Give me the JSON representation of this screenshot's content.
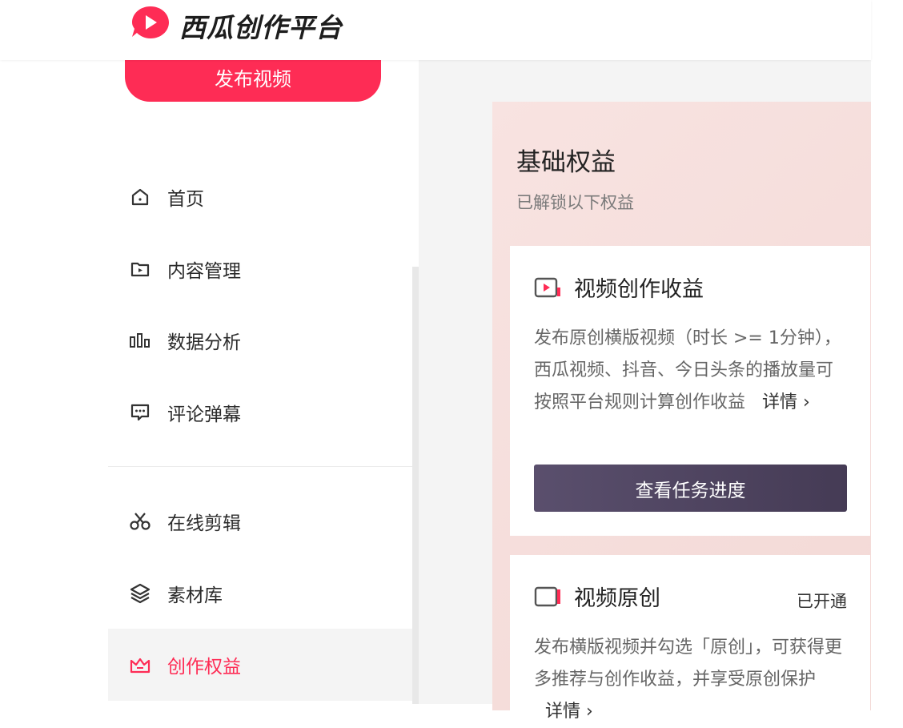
{
  "header": {
    "logo_text": "西瓜创作平台"
  },
  "sidebar": {
    "publish_label": "发布视频",
    "items": [
      {
        "label": "首页",
        "icon": "home-icon"
      },
      {
        "label": "内容管理",
        "icon": "content-icon"
      },
      {
        "label": "数据分析",
        "icon": "chart-icon"
      },
      {
        "label": "评论弹幕",
        "icon": "comment-icon"
      },
      {
        "label": "在线剪辑",
        "icon": "scissors-icon"
      },
      {
        "label": "素材库",
        "icon": "layers-icon"
      },
      {
        "label": "创作权益",
        "icon": "crown-icon",
        "active": true
      }
    ]
  },
  "main": {
    "panel_title": "基础权益",
    "panel_subtitle": "已解锁以下权益",
    "cards": [
      {
        "title": "视频创作收益",
        "desc": "发布原创横版视频（时长 >= 1分钟），西瓜视频、抖音、今日头条的播放量可按照平台规则计算创作收益",
        "detail": "详情",
        "button": "查看任务进度"
      },
      {
        "title": "视频原创",
        "badge": "已开通",
        "desc": "发布横版视频并勾选「原创」，可获得更多推荐与创作收益，并享受原创保护",
        "detail": "详情"
      }
    ]
  },
  "colors": {
    "accent": "#fe2c55",
    "button_dark": "#4d435f",
    "panel_bg": "#f6e0dd"
  }
}
